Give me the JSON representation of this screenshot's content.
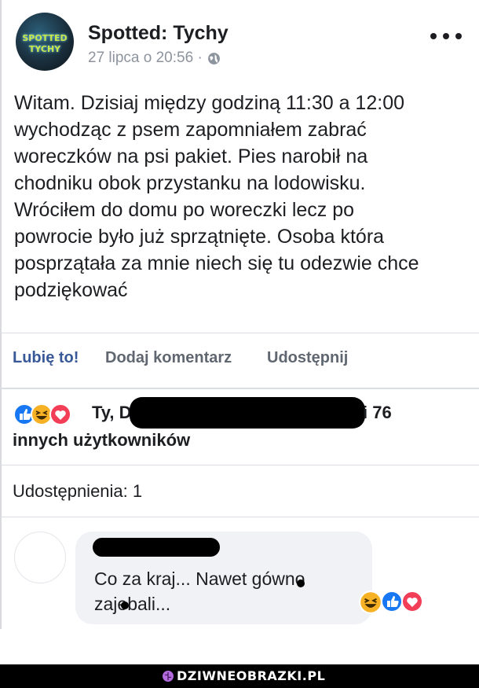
{
  "post": {
    "page_name": "Spotted: Tychy",
    "avatar_lines": [
      "SPOTTED",
      "TYCHY"
    ],
    "timestamp": "27 lipca o 20:56 ·",
    "body_lines": [
      "Witam. Dzisiaj między godziną 11:30 a 12:00",
      "wychodząc z psem zapomniałem zabrać",
      "woreczków na psi pakiet. Pies narobił na",
      "chodniku obok przystanku na lodowisku.",
      "Wróciłem do domu po woreczki lecz po",
      "powrocie było już sprzątnięte. Osoba która",
      "posprzątała za mnie niech się tu odezwie chce",
      "podziękować"
    ]
  },
  "actions": {
    "like": "Lubię to!",
    "comment": "Dodaj komentarz",
    "share": "Udostępnij"
  },
  "reactions": {
    "icons": [
      "like-icon",
      "haha-icon",
      "love-icon"
    ],
    "prefix": "Ty, D",
    "suffix": "i 76",
    "line2": "innych użytkowników"
  },
  "shares": "Udostępnienia: 1",
  "comment": {
    "lines": [
      "Co za kraj... Nawet gówno",
      "zajebali..."
    ],
    "reactions": [
      "haha-icon",
      "like-icon",
      "love-icon"
    ]
  },
  "footer": {
    "label": "DZIWNEOBRAZKI.PL"
  },
  "colors": {
    "link_blue": "#385898",
    "like_blue": "#1877f2",
    "love_red": "#f33e58",
    "haha_yellow": "#f7b125",
    "muted": "#606770"
  }
}
